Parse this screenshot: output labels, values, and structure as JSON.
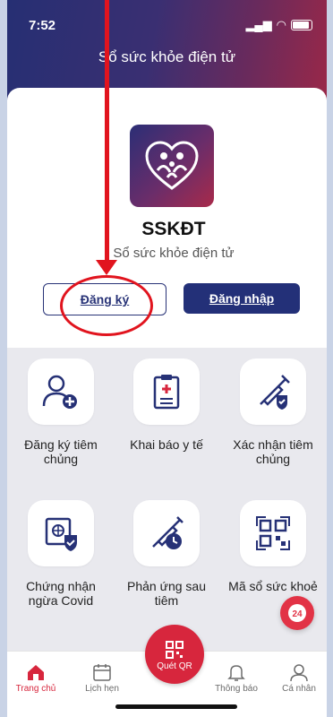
{
  "status_bar": {
    "time": "7:52"
  },
  "header": {
    "title": "Sổ sức khỏe điện tử"
  },
  "brand": {
    "name": "SSKĐT",
    "subtitle": "Sổ sức khỏe điện tử"
  },
  "auth": {
    "register_label": "Đăng ký",
    "login_label": "Đăng nhập"
  },
  "services": [
    {
      "label": "Đăng ký tiêm chủng",
      "icon": "user-add-icon"
    },
    {
      "label": "Khai báo y tế",
      "icon": "clipboard-icon"
    },
    {
      "label": "Xác nhận tiêm chủng",
      "icon": "syringe-shield-icon"
    },
    {
      "label": "Chứng nhận ngừa Covid",
      "icon": "passport-shield-icon"
    },
    {
      "label": "Phản ứng sau tiêm",
      "icon": "syringe-clock-icon"
    },
    {
      "label": "Mã sổ sức khoẻ",
      "icon": "qr-code-icon"
    }
  ],
  "fab": {
    "label": "24"
  },
  "tabbar": {
    "home": "Trang chủ",
    "schedule": "Lịch hẹn",
    "scan": "Quét QR",
    "notifications": "Thông báo",
    "profile": "Cá nhân"
  },
  "colors": {
    "primary": "#233078",
    "accent": "#d7263d",
    "annotation": "#e1141e"
  }
}
